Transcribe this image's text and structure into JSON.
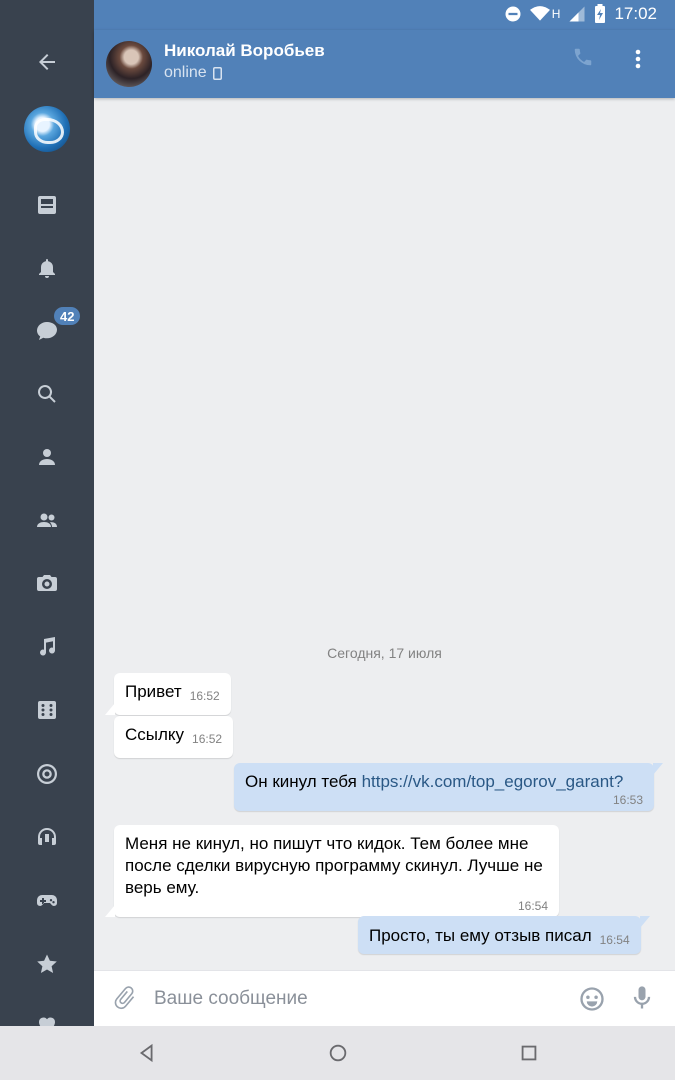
{
  "status_bar": {
    "time": "17:02",
    "network": "H"
  },
  "header": {
    "name": "Николай Воробьев",
    "status": "online"
  },
  "nav_rail": {
    "badge": "42",
    "items": [
      "back-icon",
      "profile-avatar",
      "news-icon",
      "notifications-icon",
      "messages-icon",
      "search-icon",
      "friends-icon",
      "communities-icon",
      "photos-icon",
      "music-icon",
      "games-grid-icon",
      "target-icon",
      "podcasts-icon",
      "gamepad-icon",
      "favorites-icon",
      "likes-icon"
    ]
  },
  "chat": {
    "date_separator": "Сегодня, 17 июля",
    "messages": [
      {
        "dir": "in",
        "text": "Привет",
        "time": "16:52"
      },
      {
        "dir": "in",
        "text": "Ссылку",
        "time": "16:52"
      },
      {
        "dir": "out",
        "text": "Он кинул тебя ",
        "link": "https://vk.com/top_egorov_garant?",
        "time": "16:53"
      },
      {
        "dir": "in",
        "text": "Меня не кинул, но пишут что кидок. Тем более мне после сделки вирусную программу скинул. Лучше не верь ему.",
        "time": "16:54"
      },
      {
        "dir": "out",
        "text": "Просто, ты ему отзыв писал",
        "time": "16:54"
      }
    ]
  },
  "composer": {
    "placeholder": "Ваше сообщение",
    "value": ""
  },
  "colors": {
    "header": "#5181b8",
    "rail": "#39424e",
    "outgoing_bubble": "#cddff5",
    "link": "#2a5885"
  }
}
